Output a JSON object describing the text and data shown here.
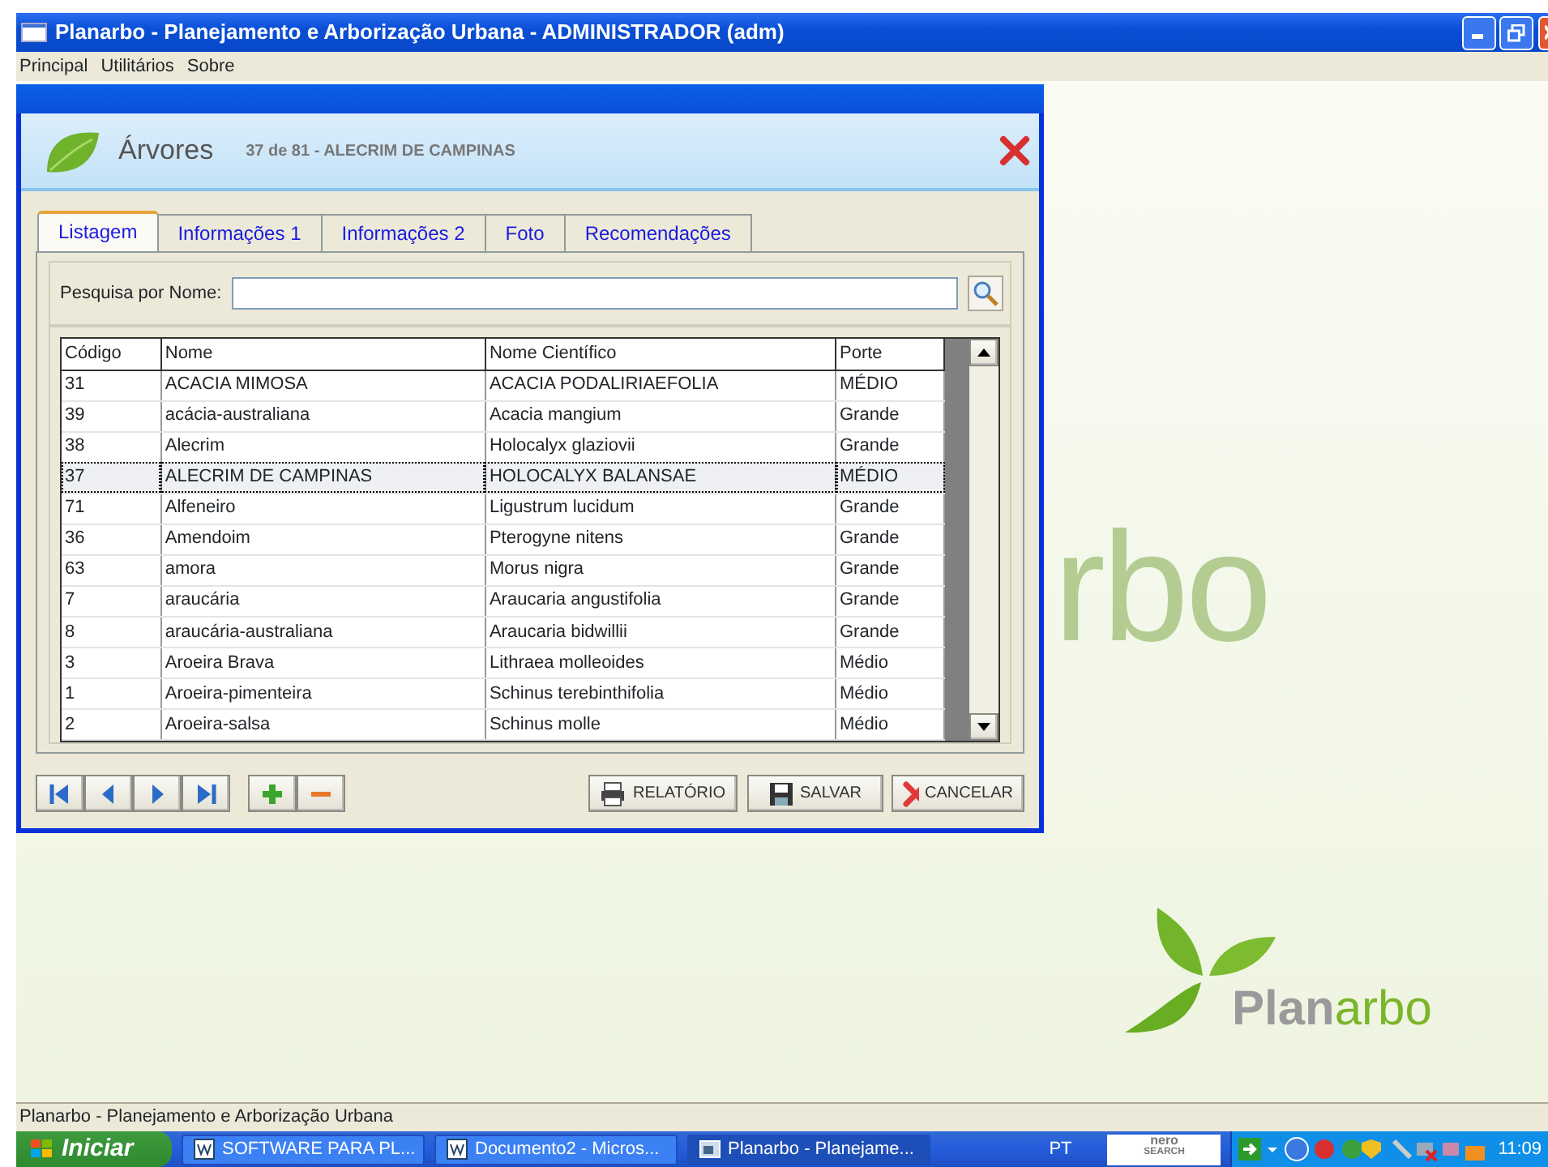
{
  "window": {
    "title": "Planarbo - Planejamento e Arborização Urbana - ADMINISTRADOR (adm)"
  },
  "menu": [
    "Principal",
    "Utilitários",
    "Sobre"
  ],
  "form": {
    "title": "Árvores",
    "subtitle": "37 de 81 - ALECRIM DE CAMPINAS"
  },
  "tabs": [
    {
      "label": "Listagem",
      "selected": true
    },
    {
      "label": "Informações 1",
      "selected": false
    },
    {
      "label": "Informações 2",
      "selected": false
    },
    {
      "label": "Foto",
      "selected": false
    },
    {
      "label": "Recomendações",
      "selected": false
    }
  ],
  "search": {
    "label": "Pesquisa por Nome:"
  },
  "table": {
    "columns": [
      "Código",
      "Nome",
      "Nome Científico",
      "Porte"
    ],
    "rows": [
      {
        "cells": [
          "31",
          "ACACIA MIMOSA",
          "ACACIA PODALIRIAEFOLIA",
          "MÉDIO"
        ],
        "selected": false
      },
      {
        "cells": [
          "39",
          "acácia-australiana",
          "Acacia mangium",
          "Grande"
        ],
        "selected": false
      },
      {
        "cells": [
          "38",
          "Alecrim",
          "Holocalyx glaziovii",
          "Grande"
        ],
        "selected": false
      },
      {
        "cells": [
          "37",
          "ALECRIM DE CAMPINAS",
          "HOLOCALYX BALANSAE",
          "MÉDIO"
        ],
        "selected": true
      },
      {
        "cells": [
          "71",
          "Alfeneiro",
          "Ligustrum lucidum",
          "Grande"
        ],
        "selected": false
      },
      {
        "cells": [
          "36",
          "Amendoim",
          "Pterogyne nitens",
          "Grande"
        ],
        "selected": false
      },
      {
        "cells": [
          "63",
          "amora",
          "Morus nigra",
          "Grande"
        ],
        "selected": false
      },
      {
        "cells": [
          "7",
          "araucária",
          "Araucaria angustifolia",
          "Grande"
        ],
        "selected": false
      },
      {
        "cells": [
          "8",
          "araucária-australiana",
          "Araucaria bidwillii",
          "Grande"
        ],
        "selected": false
      },
      {
        "cells": [
          "3",
          "Aroeira Brava",
          "Lithraea molleoides",
          "Médio"
        ],
        "selected": false
      },
      {
        "cells": [
          "1",
          "Aroeira-pimenteira",
          "Schinus terebinthifolia",
          "Médio"
        ],
        "selected": false
      },
      {
        "cells": [
          "2",
          "Aroeira-salsa",
          "Schinus molle",
          "Médio"
        ],
        "selected": false
      }
    ]
  },
  "nav_buttons": [
    {
      "kind": "first"
    },
    {
      "kind": "previous"
    },
    {
      "kind": "next"
    },
    {
      "kind": "last"
    }
  ],
  "edit_buttons": [
    {
      "kind": "add"
    },
    {
      "kind": "remove"
    }
  ],
  "actions": [
    {
      "kind": "report",
      "label": "RELATÓRIO"
    },
    {
      "kind": "save",
      "label": "SALVAR"
    },
    {
      "kind": "cancel",
      "label": "CANCELAR"
    }
  ],
  "background": {
    "watermark": "rbo",
    "logo": [
      "Plan",
      "arbo"
    ]
  },
  "status_bar": "Planarbo - Planejamento e Arborização Urbana",
  "taskbar": {
    "start": "Iniciar",
    "items": [
      {
        "label": "SOFTWARE PARA PL...",
        "kind": "document",
        "selected": false
      },
      {
        "label": "Documento2 - Micros...",
        "kind": "document",
        "selected": false
      },
      {
        "label": "Planarbo - Planejame...",
        "kind": "app",
        "selected": true
      }
    ],
    "language": "PT",
    "search_logo": [
      "nero",
      "SEARCH"
    ],
    "clock": "11:09"
  }
}
